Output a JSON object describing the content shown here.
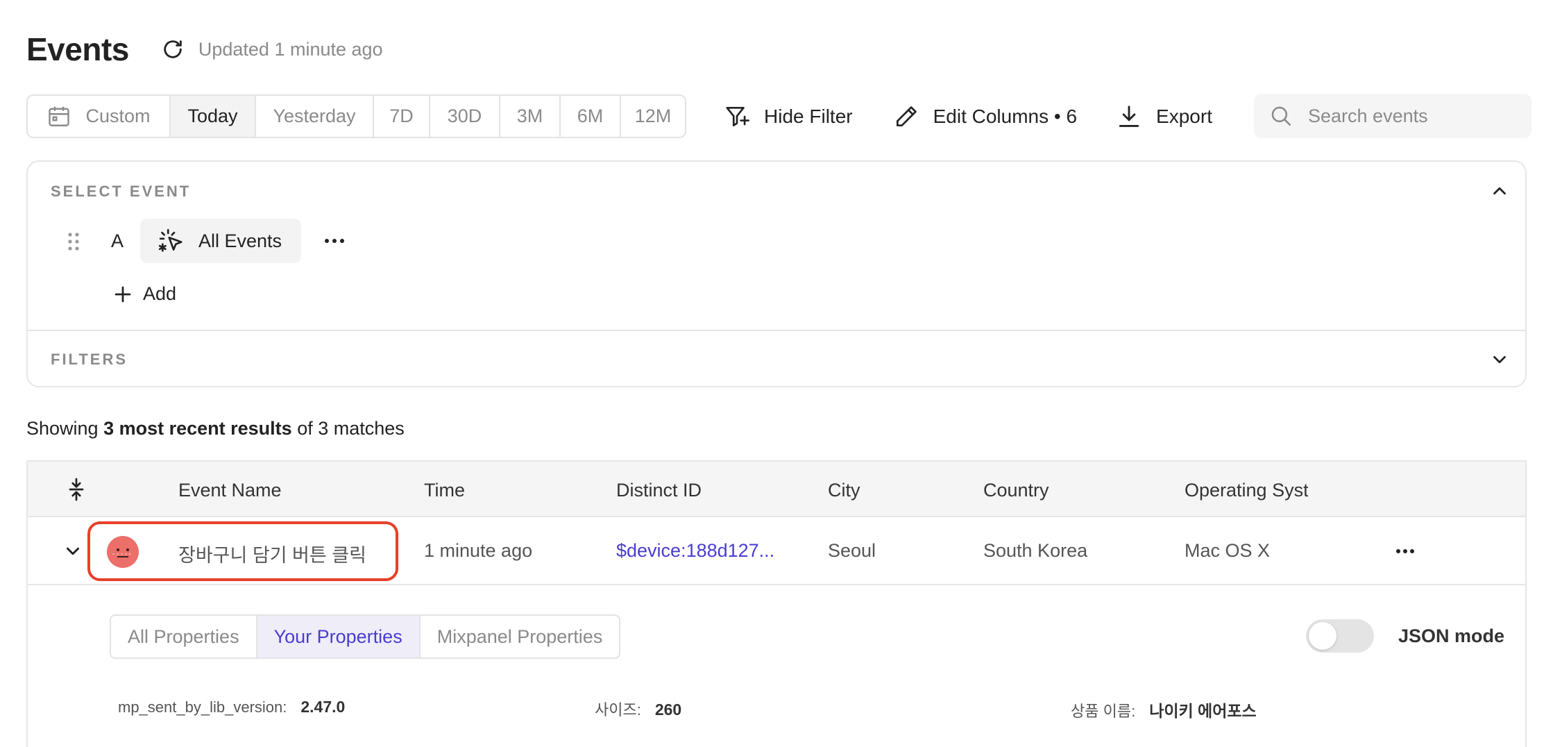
{
  "header": {
    "title": "Events",
    "updated": "Updated 1 minute ago"
  },
  "toolbar": {
    "date_ranges": [
      "Custom",
      "Today",
      "Yesterday",
      "7D",
      "30D",
      "3M",
      "6M",
      "12M"
    ],
    "active_range": "Today",
    "hide_filter": "Hide Filter",
    "edit_columns": "Edit Columns • 6",
    "export": "Export",
    "search_placeholder": "Search events"
  },
  "select_event": {
    "label": "SELECT EVENT",
    "letter": "A",
    "event": "All Events",
    "add": "Add"
  },
  "filters": {
    "label": "FILTERS"
  },
  "results": {
    "prefix": "Showing ",
    "bold": "3 most recent results",
    "suffix": " of 3 matches"
  },
  "table": {
    "columns": [
      "Event Name",
      "Time",
      "Distinct ID",
      "City",
      "Country",
      "Operating Syst"
    ],
    "rows": [
      {
        "event_name": "장바구니 담기 버튼 클릭",
        "time": "1 minute ago",
        "distinct_id": "$device:188d127...",
        "city": "Seoul",
        "country": "South Korea",
        "os": "Mac OS X"
      }
    ]
  },
  "expanded": {
    "tabs": [
      "All Properties",
      "Your Properties",
      "Mixpanel Properties"
    ],
    "active_tab": "Your Properties",
    "json_mode": "JSON mode",
    "json_mode_on": false,
    "properties": [
      {
        "key": "mp_sent_by_lib_version:",
        "value": "2.47.0"
      },
      {
        "key": "사이즈:",
        "value": "260"
      },
      {
        "key": "상품 이름:",
        "value": "나이키 에어포스"
      }
    ]
  },
  "colors": {
    "accent": "#4a3cd1",
    "highlight": "#e8402a",
    "avatar": "#ec6f6a"
  }
}
